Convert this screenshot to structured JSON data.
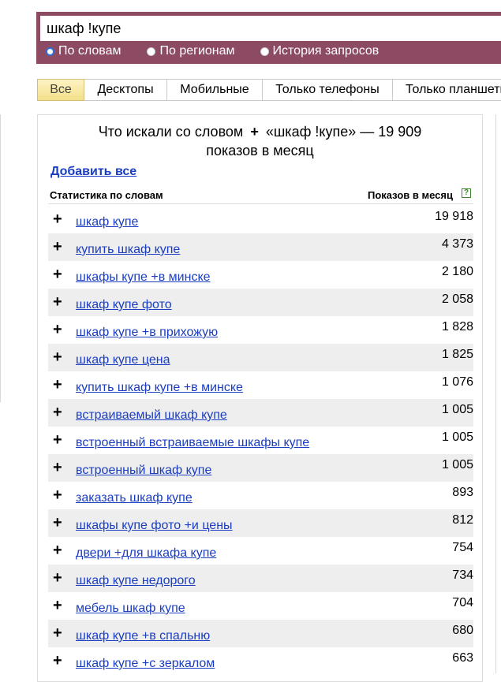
{
  "search": {
    "query": "шкаф !купе",
    "options": [
      "По словам",
      "По регионам",
      "История запросов"
    ],
    "selected_option": "По словам"
  },
  "tabs": [
    "Все",
    "Десктопы",
    "Мобильные",
    "Только телефоны",
    "Только планшеты"
  ],
  "panel": {
    "title_prefix": "Что искали со словом",
    "title_plus": "+",
    "title_query": "«шкаф !купе» — 19 909",
    "title_suffix": "показов в месяц",
    "add_all": "Добавить все",
    "col_left": "Статистика по словам",
    "col_right": "Показов в месяц",
    "help_glyph": "?",
    "row_plus": "+"
  },
  "rows": [
    {
      "phrase": "шкаф купе",
      "count": "19 918"
    },
    {
      "phrase": "купить шкаф купе",
      "count": "4 373"
    },
    {
      "phrase": "шкафы купе +в минске",
      "count": "2 180"
    },
    {
      "phrase": "шкаф купе фото",
      "count": "2 058"
    },
    {
      "phrase": "шкаф купе +в прихожую",
      "count": "1 828"
    },
    {
      "phrase": "шкаф купе цена",
      "count": "1 825"
    },
    {
      "phrase": "купить шкаф купе +в минске",
      "count": "1 076"
    },
    {
      "phrase": "встраиваемый шкаф купе",
      "count": "1 005"
    },
    {
      "phrase": "встроенный встраиваемые шкафы купе",
      "count": "1 005"
    },
    {
      "phrase": "встроенный шкаф купе",
      "count": "1 005"
    },
    {
      "phrase": "заказать шкаф купе",
      "count": "893"
    },
    {
      "phrase": "шкафы купе фото +и цены",
      "count": "812"
    },
    {
      "phrase": "двери +для шкафа купе",
      "count": "754"
    },
    {
      "phrase": "шкаф купе недорого",
      "count": "734"
    },
    {
      "phrase": "мебель шкаф купе",
      "count": "704"
    },
    {
      "phrase": "шкаф купе +в спальню",
      "count": "680"
    },
    {
      "phrase": "шкаф купе +с зеркалом",
      "count": "663"
    }
  ],
  "colors": {
    "search_band": "#8c4a63",
    "link": "#1a3dc1",
    "active_tab": "#f3e08a",
    "row_alt": "#eeeeee"
  }
}
